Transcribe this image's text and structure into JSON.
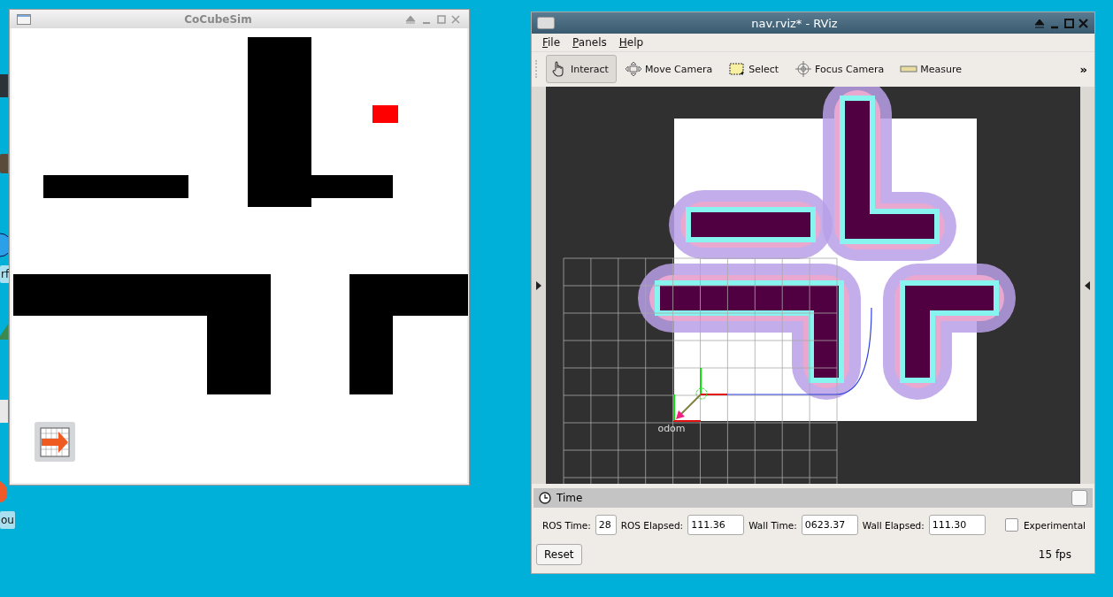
{
  "desktop": {
    "icons": [
      {
        "kind": "terminal"
      },
      {
        "kind": "box"
      },
      {
        "kind": "globe",
        "label": "rf"
      },
      {
        "kind": "pen"
      },
      {
        "kind": "edit"
      },
      {
        "kind": "flame",
        "label": "ou"
      }
    ]
  },
  "sim_window": {
    "title": "CoCubeSim"
  },
  "rviz_window": {
    "title": "nav.rviz* - RViz",
    "menu": [
      "File",
      "Panels",
      "Help"
    ],
    "tools": [
      {
        "kind": "hand",
        "label": "Interact",
        "selected": true
      },
      {
        "kind": "move",
        "label": "Move Camera",
        "selected": false
      },
      {
        "kind": "select",
        "label": "Select",
        "selected": false
      },
      {
        "kind": "focus",
        "label": "Focus Camera",
        "selected": false
      },
      {
        "kind": "ruler",
        "label": "Measure",
        "selected": false
      }
    ],
    "more": "»",
    "frame_label": "odom",
    "time_panel": {
      "title": "Time",
      "fields": [
        {
          "label": "ROS Time:",
          "value": "28"
        },
        {
          "label": "ROS Elapsed:",
          "value": "111.36"
        },
        {
          "label": "Wall Time:",
          "value": "0623.37"
        },
        {
          "label": "Wall Elapsed:",
          "value": "111.30"
        }
      ],
      "experimental": {
        "label": "Experimental",
        "checked": false
      },
      "reset": "Reset",
      "fps": "15 fps"
    }
  }
}
